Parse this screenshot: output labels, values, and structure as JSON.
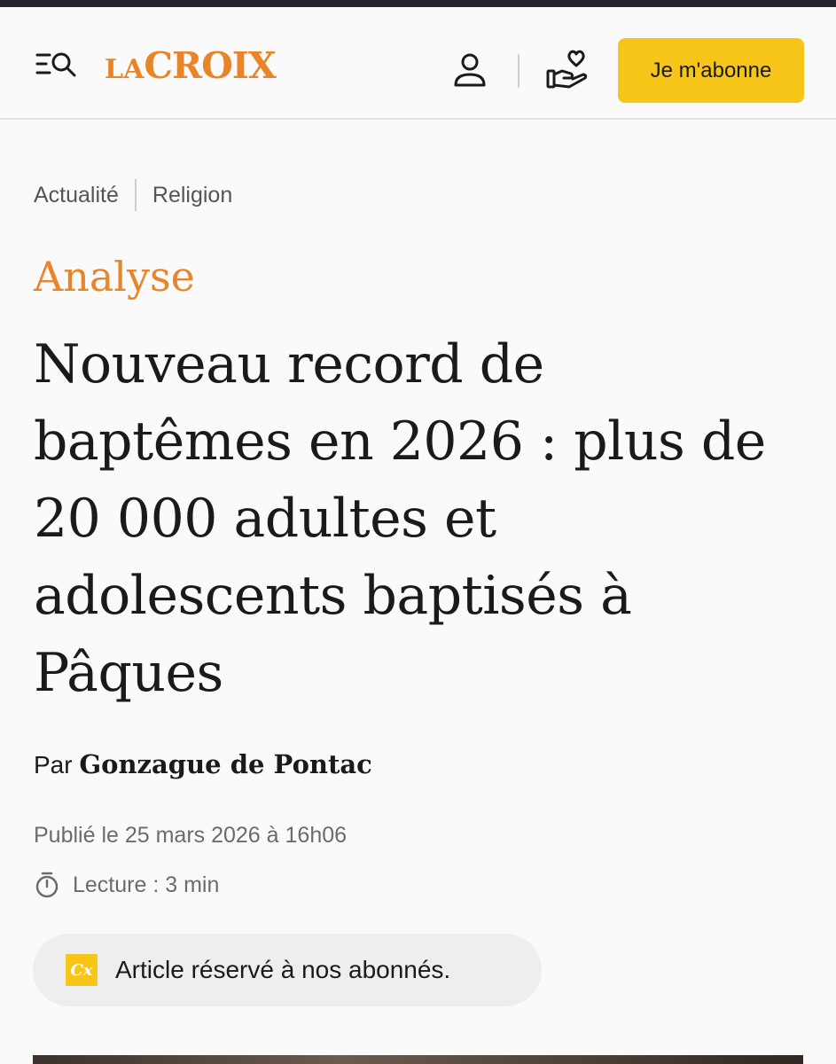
{
  "header": {
    "logo_small": "LA",
    "logo_large": "CROIX",
    "subscribe_label": "Je m'abonne"
  },
  "breadcrumb": [
    {
      "label": "Actualité"
    },
    {
      "label": "Religion"
    }
  ],
  "article": {
    "kicker": "Analyse",
    "title": "Nouveau record de baptêmes en 2026 : plus de 20 000 adultes et adolescents baptisés à Pâques",
    "byline_prefix": "Par",
    "author": "Gonzague de Pontac",
    "published": "Publié le 25 mars 2026 à 16h06",
    "reading_time": "Lecture : 3 min",
    "premium_badge": "Cx",
    "premium_notice": "Article réservé à nos abonnés."
  },
  "colors": {
    "brand_orange": "#e8842a",
    "subscribe_yellow": "#f7c517",
    "text_dark": "#1a1a1a",
    "text_muted": "#6b6b6b"
  },
  "icons": {
    "menu": "menu-search-icon",
    "account": "user-icon",
    "donate": "heart-hand-icon",
    "timer": "stopwatch-icon"
  }
}
